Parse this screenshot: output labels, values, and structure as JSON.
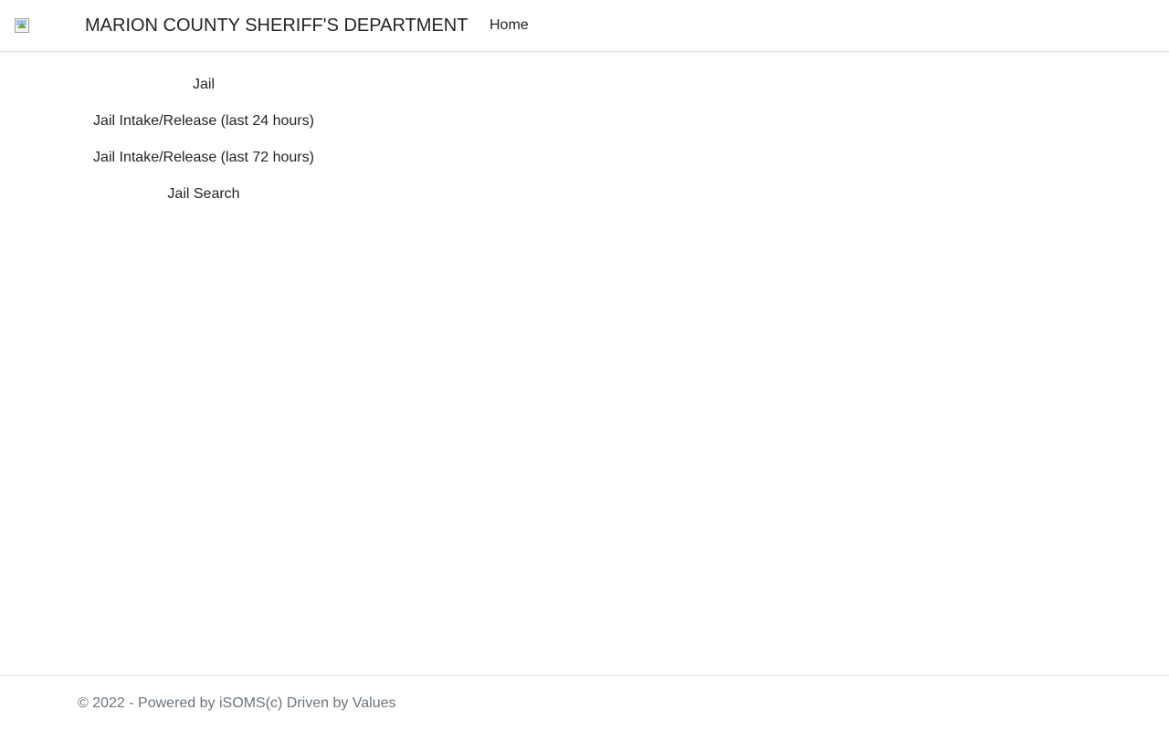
{
  "header": {
    "logo_icon": "broken-image-icon",
    "brand_title": "MARION COUNTY SHERIFF'S DEPARTMENT",
    "nav": {
      "home_label": "Home"
    }
  },
  "menu": {
    "items": [
      {
        "label": "Jail"
      },
      {
        "label": "Jail Intake/Release (last 24 hours)"
      },
      {
        "label": "Jail Intake/Release (last 72 hours)"
      },
      {
        "label": "Jail Search"
      }
    ]
  },
  "footer": {
    "copyright": "© 2022 - Powered by iSOMS(c) Driven by Values"
  },
  "colors": {
    "text": "#212529",
    "muted": "#6c757d",
    "border": "#dee2e6",
    "background": "#ffffff"
  }
}
